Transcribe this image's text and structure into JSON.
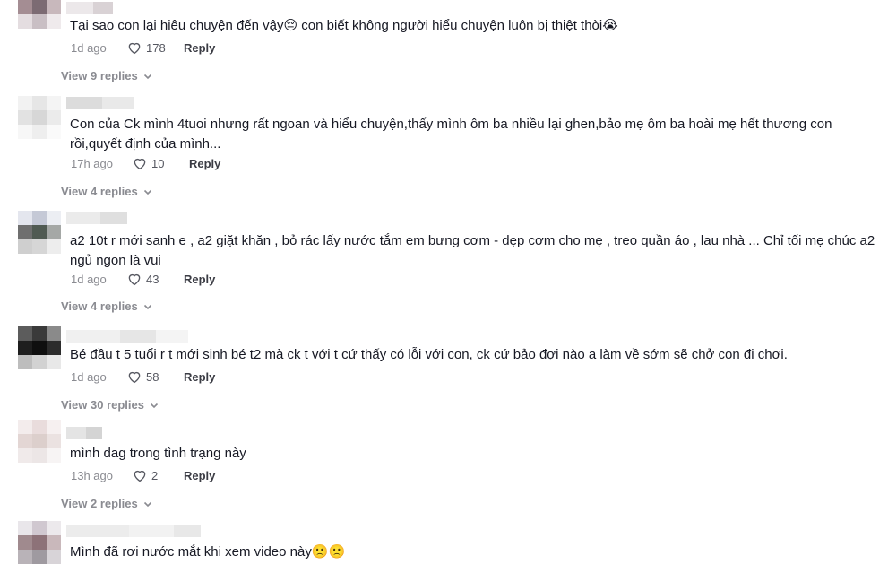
{
  "comments": [
    {
      "text": "Tại sao con lại hiêu chuyện đến vậy😔 con biết không người hiểu chuyện luôn bị thiệt thòi😭",
      "time": "1d ago",
      "likes": "178",
      "reply_label": "Reply",
      "view_replies": "View 9 replies"
    },
    {
      "text": "Con của Ck mình 4tuoi nhưng rất ngoan và hiểu chuyện,thấy mình ôm ba nhiều lại ghen,bảo mẹ ôm ba hoài mẹ hết thương con rồi,quyết định của mình...",
      "time": "17h ago",
      "likes": "10",
      "reply_label": "Reply",
      "view_replies": "View 4 replies"
    },
    {
      "text": "a2 10t r mới sanh e , a2 giặt khăn , bỏ rác lấy nước tắm em bưng cơm - dẹp cơm cho mẹ , treo quần áo , lau nhà ... Chỉ tối mẹ chúc a2 ngủ ngon là vui",
      "time": "1d ago",
      "likes": "43",
      "reply_label": "Reply",
      "view_replies": "View 4 replies"
    },
    {
      "text": "Bé đầu t 5 tuổi r t mới sinh bé t2 mà ck t với t cứ thấy có lỗi với con, ck cứ bảo đợi nào a làm về sớm sẽ chở con đi chơi.",
      "time": "1d ago",
      "likes": "58",
      "reply_label": "Reply",
      "view_replies": "View 30 replies"
    },
    {
      "text": "mình dag trong tình trạng này",
      "time": "13h ago",
      "likes": "2",
      "reply_label": "Reply",
      "view_replies": "View 2 replies"
    },
    {
      "text": "Mình đã rơi nước mắt khi xem video này🙁🙁"
    }
  ],
  "icons": {
    "like": "heart-outline-icon",
    "expand": "chevron-down-icon"
  },
  "colors": {
    "text": "#161823",
    "muted": "#8a8b91",
    "reply": "#3b3c44"
  }
}
